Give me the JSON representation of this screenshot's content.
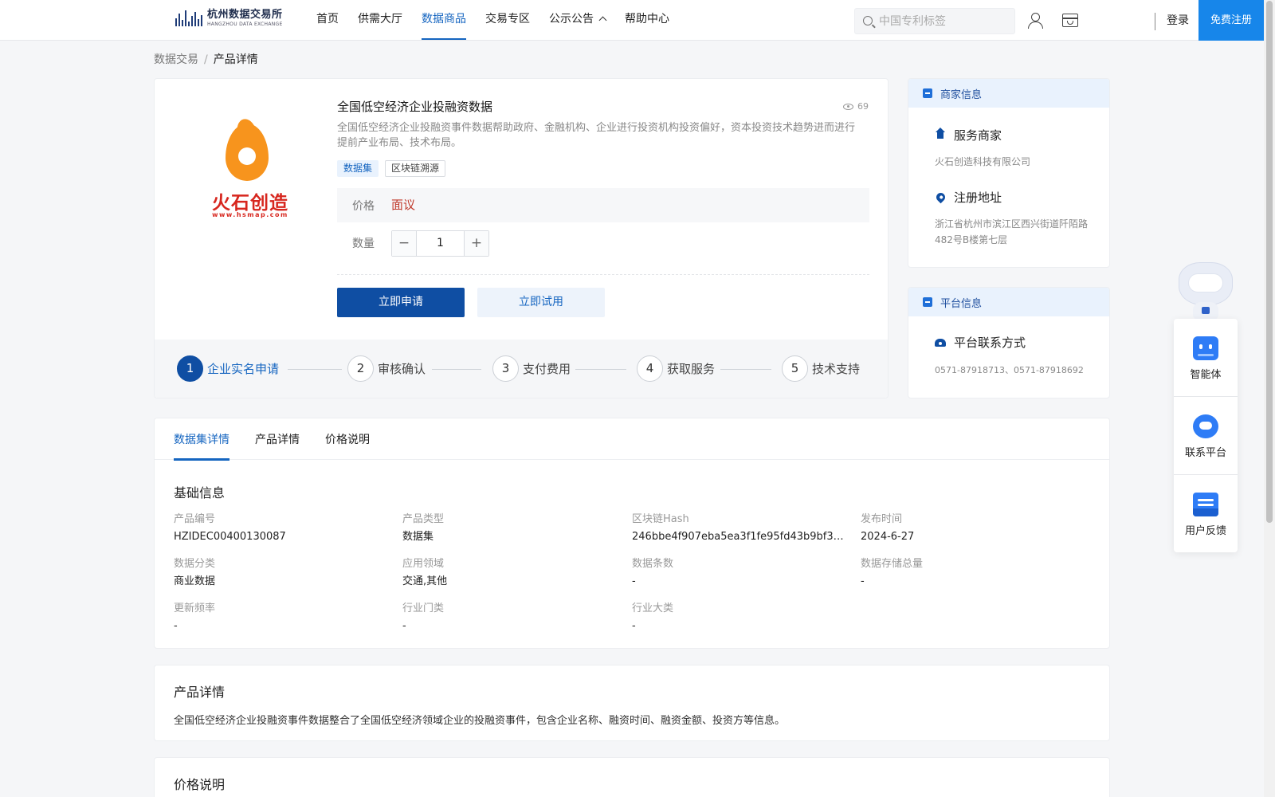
{
  "header": {
    "logo_cn": "杭州数据交易所",
    "logo_en": "HANGZHOU DATA EXCHANGE",
    "nav": [
      "首页",
      "供需大厅",
      "数据商品",
      "交易专区",
      "公示公告",
      "帮助中心"
    ],
    "active_nav_index": 2,
    "search_placeholder": "中国专利标签",
    "login": "登录",
    "register": "免费注册",
    "accent_color": "#1565c0"
  },
  "breadcrumb": {
    "parent": "数据交易",
    "separator": "/",
    "current": "产品详情"
  },
  "product": {
    "logo_name": "火石创造",
    "logo_url_text": "www.hsmap.com",
    "title": "全国低空经济企业投融资数据",
    "views": "69",
    "description": "全国低空经济企业投融资事件数据帮助政府、金融机构、企业进行投资机构投资偏好，资本投资技术趋势进而进行提前产业布局、技术布局。",
    "tags": [
      "数据集",
      "区块链溯源"
    ],
    "price_label": "价格",
    "price_value": "面议",
    "qty_label": "数量",
    "qty_minus": "−",
    "qty_value": "1",
    "qty_plus": "+",
    "apply_button": "立即申请",
    "trial_button": "立即试用",
    "steps": [
      {
        "num": "1",
        "label": "企业实名申请"
      },
      {
        "num": "2",
        "label": "审核确认"
      },
      {
        "num": "3",
        "label": "支付费用"
      },
      {
        "num": "4",
        "label": "获取服务"
      },
      {
        "num": "5",
        "label": "技术支持"
      }
    ],
    "active_step_index": 0
  },
  "merchant": {
    "title": "商家信息",
    "service_label": "服务商家",
    "service_value": "火石创造科技有限公司",
    "address_label": "注册地址",
    "address_value": "浙江省杭州市滨江区西兴街道阡陌路482号B楼第七层"
  },
  "platform": {
    "title": "平台信息",
    "contact_label": "平台联系方式",
    "contact_value": "0571-87918713、0571-87918692"
  },
  "tabs": [
    "数据集详情",
    "产品详情",
    "价格说明"
  ],
  "active_tab_index": 0,
  "basic_info": {
    "title": "基础信息",
    "fields": [
      {
        "label": "产品编号",
        "value": "HZIDEC00400130087"
      },
      {
        "label": "产品类型",
        "value": "数据集"
      },
      {
        "label": "区块链Hash",
        "value": "246bbe4f907eba5ea3f1fe95fd43b9bf3c4a..."
      },
      {
        "label": "发布时间",
        "value": "2024-6-27"
      },
      {
        "label": "数据分类",
        "value": "商业数据"
      },
      {
        "label": "应用领域",
        "value": "交通,其他"
      },
      {
        "label": "数据条数",
        "value": "-"
      },
      {
        "label": "数据存储总量",
        "value": "-"
      },
      {
        "label": "更新频率",
        "value": "-"
      },
      {
        "label": "行业门类",
        "value": "-"
      },
      {
        "label": "行业大类",
        "value": "-"
      }
    ]
  },
  "product_detail": {
    "title": "产品详情",
    "text": "全国低空经济企业投融资事件数据整合了全国低空经济领域企业的投融资事件，包含企业名称、融资时间、融资金额、投资方等信息。"
  },
  "price_section": {
    "title": "价格说明"
  },
  "float_panel": {
    "items": [
      "智能体",
      "联系平台",
      "用户反馈"
    ]
  }
}
